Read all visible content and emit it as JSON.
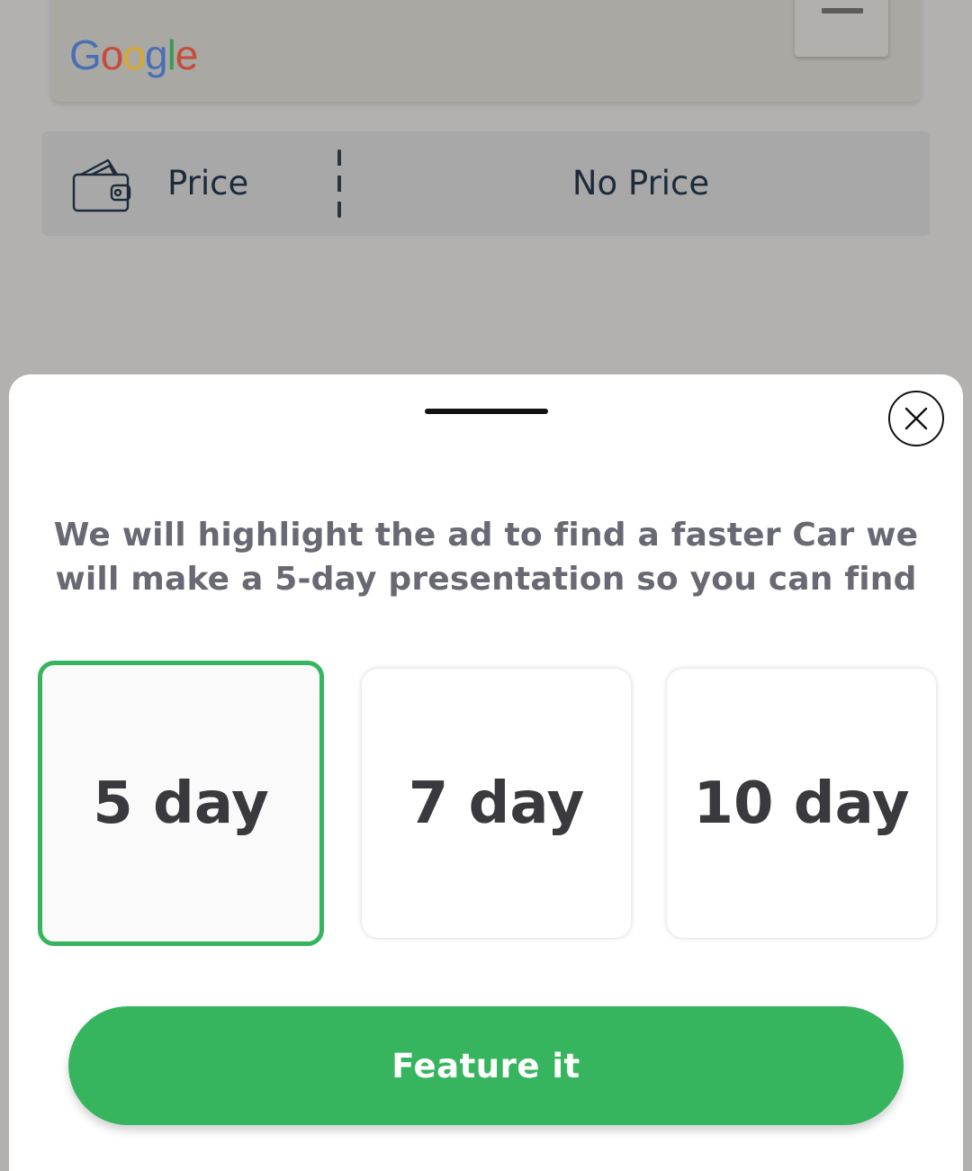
{
  "background": {
    "map": {
      "logo_text": "Google",
      "zoom_out_icon": "minus-icon"
    },
    "price_row": {
      "icon": "wallet-icon",
      "label": "Price",
      "value": "No Price"
    }
  },
  "sheet": {
    "close_icon": "close-icon",
    "description": "We will highlight the ad to find a faster Car we will make a 5-day presentation so you can find",
    "options": [
      {
        "label": "5 day",
        "selected": true
      },
      {
        "label": "7 day",
        "selected": false
      },
      {
        "label": "10 day",
        "selected": false
      }
    ],
    "feature_button_label": "Feature it"
  },
  "colors": {
    "accent": "#36b55e",
    "overlay": "#b3b1b0",
    "text_muted": "#696973",
    "text_dark": "#3a3a3e"
  }
}
